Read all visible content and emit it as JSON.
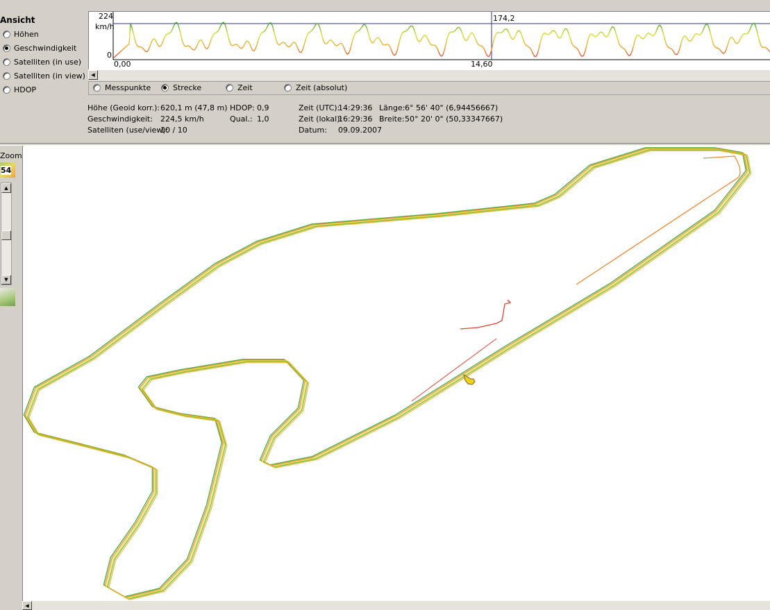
{
  "ansicht": {
    "title": "Ansicht",
    "options": [
      {
        "label": "Höhen",
        "checked": false
      },
      {
        "label": "Geschwindigkeit",
        "checked": true
      },
      {
        "label": "Satelliten (in use)",
        "checked": false
      },
      {
        "label": "Satelliten (in view)",
        "checked": false
      },
      {
        "label": "HDOP",
        "checked": false
      }
    ]
  },
  "chart": {
    "y_max_label": "224",
    "y_unit_label": "km/h",
    "y_min_label": "0",
    "x_start_label": "0,00",
    "cursor_x_label": "14,60",
    "cursor_value_label": "174,2"
  },
  "xaxis_mode": {
    "options": [
      {
        "label": "Messpunkte",
        "checked": false
      },
      {
        "label": "Strecke",
        "checked": true
      },
      {
        "label": "Zeit",
        "checked": false
      },
      {
        "label": "Zeit (absolut)",
        "checked": false
      }
    ]
  },
  "info": {
    "hoehe_label": "Höhe (Geoid korr.):",
    "hoehe_value": "620,1 m (47,8 m)",
    "geschw_label": "Geschwindigkeit:",
    "geschw_value": "224,5 km/h",
    "sat_label": "Satelliten (use/view):",
    "sat_value": "10 / 10",
    "hdop_label": "HDOP:",
    "hdop_value": "0,9",
    "qual_label": "Qual.:",
    "qual_value": "1,0",
    "zeit_utc_label": "Zeit (UTC):",
    "zeit_utc_value": "14:29:36",
    "zeit_lokal_label": "Zeit (lokal):",
    "zeit_lokal_value": "16:29:36",
    "datum_label": "Datum:",
    "datum_value": "09.09.2007",
    "laenge_label": "Länge:",
    "laenge_value": "6° 56' 40\" (6,94456667)",
    "breite_label": "Breite:",
    "breite_value": "50° 20' 0\" (50,33347667)"
  },
  "zoom": {
    "label": "Zoom",
    "level": "54"
  },
  "colors": {
    "track_slow": "#f08020",
    "track_mid": "#e8e020",
    "track_fast": "#30a020",
    "pit_lane": "#e04030",
    "chart_line": "#3030a0"
  }
}
